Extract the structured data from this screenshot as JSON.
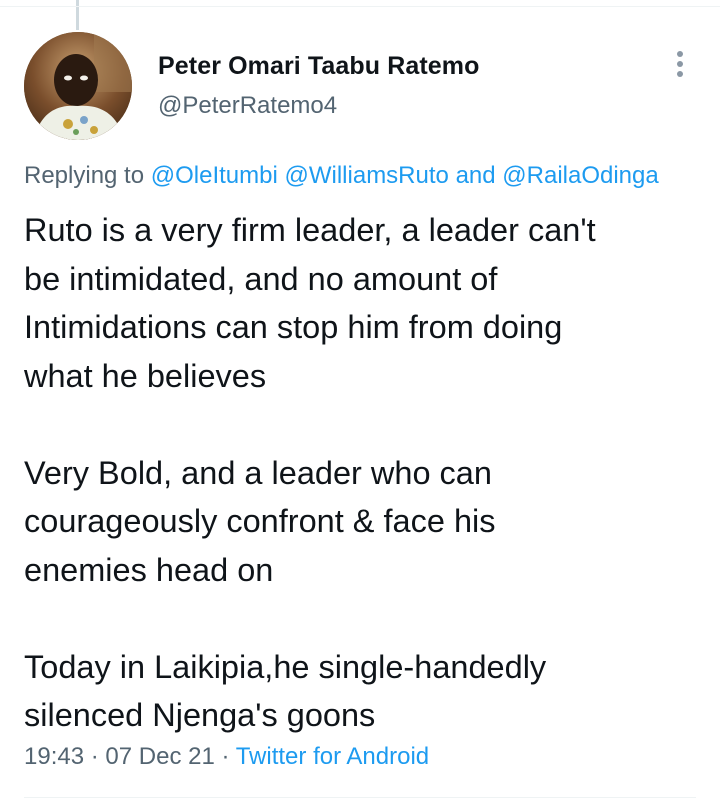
{
  "author": {
    "name": "Peter Omari Taabu Ratemo",
    "handle": "@PeterRatemo4",
    "avatar_icon": "profile-photo-avatar"
  },
  "menu_icon": "more-vertical-icon",
  "replying_to": {
    "prefix": "Replying to",
    "mentions": [
      "@OleItumbi",
      "@WilliamsRuto"
    ],
    "joiner": "and",
    "last_mention": "@RailaOdinga"
  },
  "tweet": {
    "paragraphs": [
      [
        "Ruto is a very firm leader, a leader  can't",
        "be intimidated, and no amount of",
        "Intimidations can stop him from doing",
        "what he believes"
      ],
      [
        "Very Bold, and a leader who can",
        "courageously confront & face his",
        "enemies head on"
      ],
      [
        "Today in Laikipia,he single-handedly",
        "silenced Njenga's goons"
      ]
    ]
  },
  "meta": {
    "time": "19:43",
    "separator": "·",
    "date": "07 Dec 21",
    "source": "Twitter for Android"
  },
  "colors": {
    "text": "#0f1419",
    "secondary": "#536471",
    "link": "#1d9bf0",
    "divider": "#eff3f4"
  }
}
